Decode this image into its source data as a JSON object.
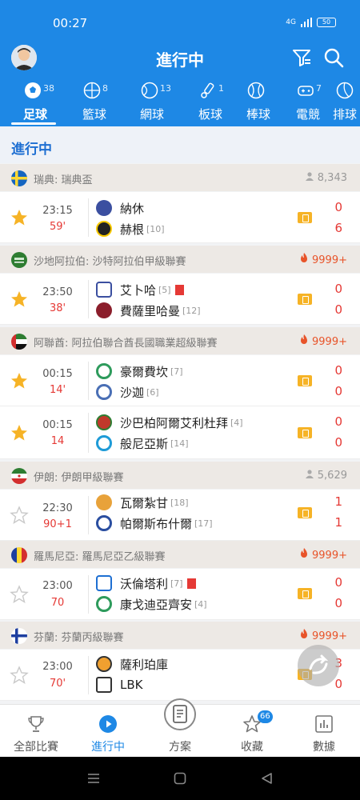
{
  "status_bar": {
    "time": "00:27",
    "network": "4G",
    "battery": "50"
  },
  "header": {
    "title": "進行中"
  },
  "tabs": [
    {
      "label": "足球",
      "count": "38",
      "icon": "soccer-icon"
    },
    {
      "label": "籃球",
      "count": "8",
      "icon": "basketball-icon"
    },
    {
      "label": "網球",
      "count": "13",
      "icon": "tennis-icon"
    },
    {
      "label": "板球",
      "count": "1",
      "icon": "cricket-icon"
    },
    {
      "label": "棒球",
      "count": "",
      "icon": "baseball-icon"
    },
    {
      "label": "電競",
      "count": "7",
      "icon": "gamepad-icon"
    },
    {
      "label": "排球",
      "count": "",
      "icon": "volleyball-icon"
    }
  ],
  "section": {
    "title": "進行中"
  },
  "leagues": [
    {
      "name": "瑞典: 瑞典盃",
      "stat": "8,343",
      "stat_type": "viewers",
      "matches": [
        {
          "time": "23:15",
          "minute": "59'",
          "starred": true,
          "home": {
            "name": "納休",
            "rank": "",
            "red_cards": 0
          },
          "away": {
            "name": "赫根",
            "rank": "[10]",
            "red_cards": 0
          },
          "home_score": "0",
          "away_score": "6"
        }
      ]
    },
    {
      "name": "沙地阿拉伯: 沙特阿拉伯甲級聯賽",
      "stat": "9999+",
      "stat_type": "hot",
      "matches": [
        {
          "time": "23:50",
          "minute": "38'",
          "starred": true,
          "home": {
            "name": "艾卜哈",
            "rank": "[5]",
            "red_cards": 1
          },
          "away": {
            "name": "費薩里哈曼",
            "rank": "[12]",
            "red_cards": 0
          },
          "home_score": "0",
          "away_score": "0"
        }
      ]
    },
    {
      "name": "阿聯酋: 阿拉伯聯合酋長國職業超級聯賽",
      "stat": "9999+",
      "stat_type": "hot",
      "matches": [
        {
          "time": "00:15",
          "minute": "14'",
          "starred": true,
          "home": {
            "name": "豪爾費坎",
            "rank": "[7]",
            "red_cards": 0
          },
          "away": {
            "name": "沙迦",
            "rank": "[6]",
            "red_cards": 0
          },
          "home_score": "0",
          "away_score": "0"
        },
        {
          "time": "00:15",
          "minute": "14",
          "starred": true,
          "home": {
            "name": "沙巴柏阿爾艾利杜拜",
            "rank": "[4]",
            "red_cards": 0
          },
          "away": {
            "name": "般尼亞斯",
            "rank": "[14]",
            "red_cards": 0
          },
          "home_score": "0",
          "away_score": "0"
        }
      ]
    },
    {
      "name": "伊朗: 伊朗甲級聯賽",
      "stat": "5,629",
      "stat_type": "viewers",
      "matches": [
        {
          "time": "22:30",
          "minute": "90+1",
          "starred": false,
          "home": {
            "name": "瓦爾紮甘",
            "rank": "[18]",
            "red_cards": 0
          },
          "away": {
            "name": "帕爾斯布什爾",
            "rank": "[17]",
            "red_cards": 0
          },
          "home_score": "1",
          "away_score": "1"
        }
      ]
    },
    {
      "name": "羅馬尼亞: 羅馬尼亞乙級聯賽",
      "stat": "9999+",
      "stat_type": "hot",
      "matches": [
        {
          "time": "23:00",
          "minute": "70",
          "starred": false,
          "home": {
            "name": "沃倫塔利",
            "rank": "[7]",
            "red_cards": 1
          },
          "away": {
            "name": "康戈迪亞齊安",
            "rank": "[4]",
            "red_cards": 0
          },
          "home_score": "0",
          "away_score": "0"
        }
      ]
    },
    {
      "name": "芬蘭: 芬蘭丙級聯賽",
      "stat": "9999+",
      "stat_type": "hot",
      "matches": [
        {
          "time": "23:00",
          "minute": "70'",
          "starred": false,
          "home": {
            "name": "薩利珀庫",
            "rank": "",
            "red_cards": 0
          },
          "away": {
            "name": "LBK",
            "rank": "",
            "red_cards": 0
          },
          "home_score": "3",
          "away_score": "0"
        }
      ]
    }
  ],
  "bottom_nav": [
    {
      "label": "全部比賽",
      "icon": "trophy-icon"
    },
    {
      "label": "進行中",
      "icon": "play-icon"
    },
    {
      "label": "方案",
      "icon": "document-icon"
    },
    {
      "label": "收藏",
      "icon": "star-icon",
      "badge": "66"
    },
    {
      "label": "數據",
      "icon": "chart-icon"
    }
  ],
  "colors": {
    "primary": "#1e88e5",
    "live_red": "#e53935",
    "star_gold": "#f6b326",
    "league_bg": "#ede9e5"
  }
}
